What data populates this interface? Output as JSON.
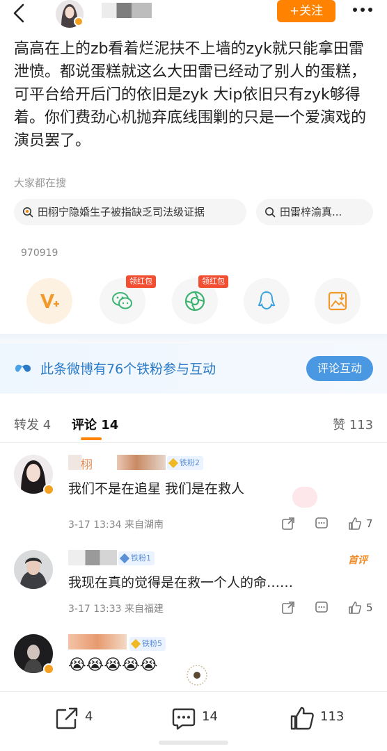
{
  "header": {
    "follow_label": "+关注"
  },
  "post": {
    "text": "高高在上的zb看着烂泥扶不上墙的zyk就只能拿田雷泄愤。都说蛋糕就这么大田雷已经动了别人的蛋糕，可平台给开后门的依旧是zyk 大ip依旧只有zyk够得着。你们费劲心机抛弃底线围剿的只是一个爱演戏的演员罢了。"
  },
  "search": {
    "label": "大家都在搜",
    "chips": [
      "田栩宁隐婚生子被指缺乏司法级证据",
      "田雷梓渝真..."
    ]
  },
  "post_id": "970919",
  "share": {
    "items": [
      "vplus-icon",
      "wechat-icon",
      "moments-icon",
      "qq-icon",
      "save-image-icon"
    ],
    "redpack_label": "领红包"
  },
  "fans_banner": {
    "text": "此条微博有76个铁粉参与互动",
    "button": "评论互动"
  },
  "tabs": {
    "repost": "转发 4",
    "comment": "评论 14",
    "like": "赞 113"
  },
  "comments": [
    {
      "name_fragment": "栩",
      "badge": "铁粉2",
      "text": "我们不是在追星 我们是在救人",
      "meta": "3-17 13:34  来自湖南",
      "likes": "7"
    },
    {
      "badge": "铁粉1",
      "tag": "首评",
      "text": "我现在真的觉得是在救一个人的命……",
      "meta": "3-17 13:33  来自福建",
      "likes": "5"
    },
    {
      "badge": "铁粉5",
      "text": "😭😭😭😭😭"
    }
  ],
  "bottom_bar": {
    "repost_count": "4",
    "comment_count": "14",
    "like_count": "113"
  },
  "colors": {
    "accent": "#ff8200",
    "link_blue": "#2a7ac6",
    "button_blue": "#4a98e1",
    "redpack": "#f24e32"
  }
}
